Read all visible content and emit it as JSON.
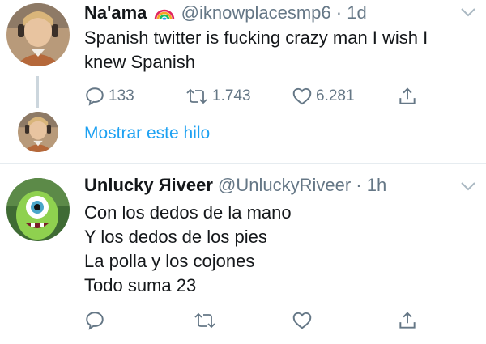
{
  "tweet1": {
    "name": "Na'ama",
    "name_emoji": "rainbow-icon",
    "handle": "@iknowplacesmp6",
    "separator": "·",
    "time": "1d",
    "text_lines": [
      "Spanish twitter is fucking crazy man I wish I",
      "knew Spanish"
    ],
    "stats": {
      "replies": "133",
      "retweets": "1.743",
      "likes": "6.281"
    },
    "show_thread": "Mostrar este hilo"
  },
  "tweet2": {
    "name": "Unlucky Яiveer",
    "handle": "@UnluckyRiveer",
    "separator": "·",
    "time": "1h",
    "text_lines": [
      "Con los dedos de la mano",
      "Y los dedos de los pies",
      "La polla y los cojones",
      "Todo suma 23"
    ]
  },
  "colors": {
    "link": "#1da1f2",
    "muted": "#657786",
    "text": "#14171a",
    "divider": "#e6ecf0"
  }
}
